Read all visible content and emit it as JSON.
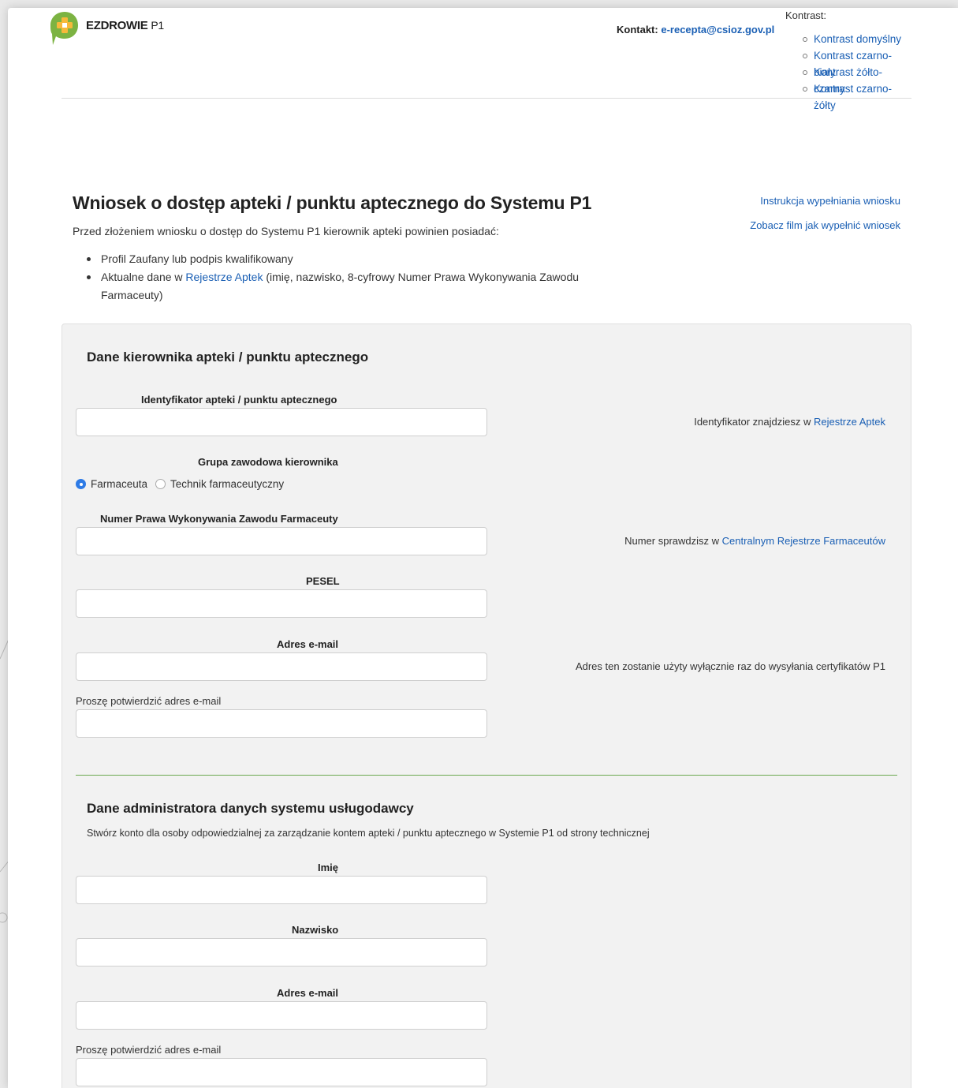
{
  "header": {
    "logo_text": "EZDROWIE",
    "logo_suffix": "P1",
    "contact_label": "Kontakt:",
    "contact_email": "e-recepta@csioz.gov.pl",
    "contrast_title": "Kontrast:",
    "contrast_options": [
      "Kontrast domyślny",
      "Kontrast czarno-biały",
      "Kontrast żółto-czarny",
      "Kontrast czarno-żółty"
    ]
  },
  "intro": {
    "title": "Wniosek o dostęp apteki / punktu aptecznego do Systemu P1",
    "lead": "Przed złożeniem wniosku o dostęp do Systemu P1 kierownik apteki powinien posiadać:",
    "bullet_1": "Profil Zaufany lub podpis kwalifikowany",
    "bullet_2_prefix": "Aktualne dane w ",
    "bullet_2_link": "Rejestrze Aptek",
    "bullet_2_suffix": " (imię, nazwisko, 8-cyfrowy Numer Prawa Wykonywania Zawodu Farmaceuty)",
    "link_instructions": "Instrukcja wypełniania wniosku",
    "link_video": "Zobacz film jak wypełnić wniosek"
  },
  "section_manager": {
    "title": "Dane kierownika apteki / punktu aptecznego",
    "pharmacy_id_label": "Identyfikator apteki / punktu aptecznego",
    "pharmacy_id_hint_prefix": "Identyfikator znajdziesz w ",
    "pharmacy_id_hint_link": "Rejestrze Aptek",
    "group_label": "Grupa zawodowa kierownika",
    "group_options": [
      "Farmaceuta",
      "Technik farmaceutyczny"
    ],
    "group_selected": "Farmaceuta",
    "license_label": "Numer Prawa Wykonywania Zawodu Farmaceuty",
    "license_hint_prefix": "Numer sprawdzisz w ",
    "license_hint_link": "Centralnym Rejestrze Farmaceutów",
    "pesel_label": "PESEL",
    "email_label": "Adres e-mail",
    "email_hint": "Adres ten zostanie użyty wyłącznie raz do wysyłania certyfikatów P1",
    "email_confirm_label": "Proszę potwierdzić adres e-mail"
  },
  "section_admin": {
    "title": "Dane administratora danych systemu usługodawcy",
    "description": "Stwórz konto dla osoby odpowiedzialnej za zarządzanie kontem apteki / punktu aptecznego w Systemie P1 od strony technicznej",
    "first_name_label": "Imię",
    "last_name_label": "Nazwisko",
    "email_label": "Adres e-mail",
    "email_confirm_label": "Proszę potwierdzić adres e-mail"
  },
  "colors": {
    "link": "#1a5fb4",
    "panel": "#f2f2f2",
    "divider": "#6aa84f",
    "logo_green": "#7cb342",
    "radio_active": "#2e7be6"
  }
}
